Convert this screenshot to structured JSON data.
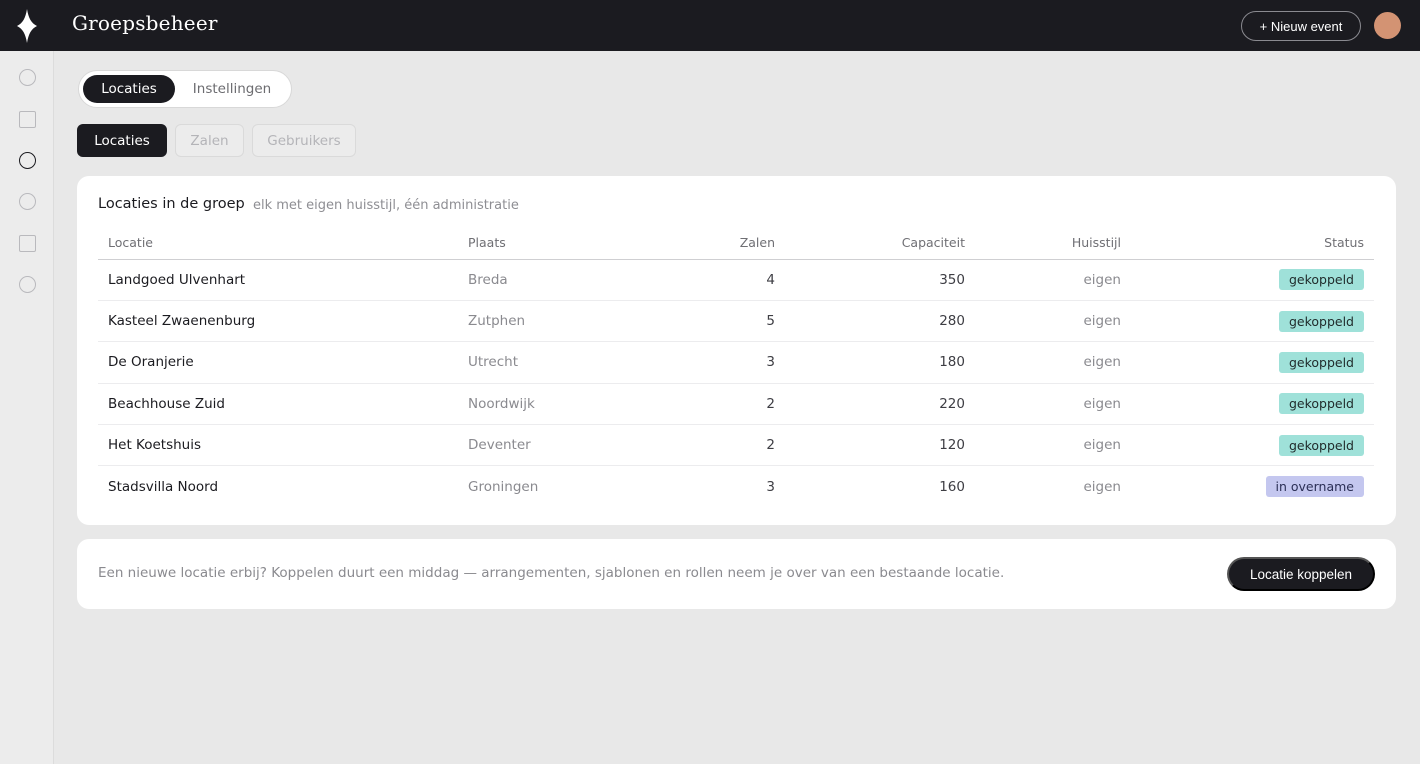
{
  "app": {
    "title": "Groepsbeheer"
  },
  "header": {
    "new_event_label": "+ Nieuw event"
  },
  "sidebar": {
    "icons": [
      "circle-icon",
      "square-icon",
      "circle-icon",
      "circle-icon",
      "square-icon",
      "circle-icon"
    ],
    "active_index": 2
  },
  "top_tabs": {
    "active": "Locaties",
    "inactive": "Instellingen"
  },
  "sub_tabs": {
    "items": [
      "Locaties",
      "Zalen",
      "Gebruikers"
    ],
    "active_index": 0
  },
  "locations_card": {
    "title": "Locaties in de groep",
    "subtitle": "elk met eigen huisstijl, één administratie",
    "columns": [
      "Locatie",
      "Plaats",
      "Zalen",
      "Capaciteit",
      "Huisstijl",
      "Status"
    ],
    "rows": [
      {
        "locatie": "Landgoed Ulvenhart",
        "plaats": "Breda",
        "zalen": "4",
        "capaciteit": "350",
        "huisstijl": "eigen",
        "status": "gekoppeld"
      },
      {
        "locatie": "Kasteel Zwaenenburg",
        "plaats": "Zutphen",
        "zalen": "5",
        "capaciteit": "280",
        "huisstijl": "eigen",
        "status": "gekoppeld"
      },
      {
        "locatie": "De Oranjerie",
        "plaats": "Utrecht",
        "zalen": "3",
        "capaciteit": "180",
        "huisstijl": "eigen",
        "status": "gekoppeld"
      },
      {
        "locatie": "Beachhouse Zuid",
        "plaats": "Noordwijk",
        "zalen": "2",
        "capaciteit": "220",
        "huisstijl": "eigen",
        "status": "gekoppeld"
      },
      {
        "locatie": "Het Koetshuis",
        "plaats": "Deventer",
        "zalen": "2",
        "capaciteit": "120",
        "huisstijl": "eigen",
        "status": "gekoppeld"
      },
      {
        "locatie": "Stadsvilla Noord",
        "plaats": "Groningen",
        "zalen": "3",
        "capaciteit": "160",
        "huisstijl": "eigen",
        "status": "in overname"
      }
    ]
  },
  "footer_card": {
    "text": "Een nieuwe locatie erbij? Koppelen duurt een middag — arrangementen, sjablonen en rollen neem je over van een bestaande locatie.",
    "button_label": "Locatie koppelen"
  },
  "colors": {
    "dark": "#1b1b20",
    "linked_badge": "#9fe1d9",
    "transfer_badge": "#c4c7ef",
    "avatar": "#d39373"
  }
}
